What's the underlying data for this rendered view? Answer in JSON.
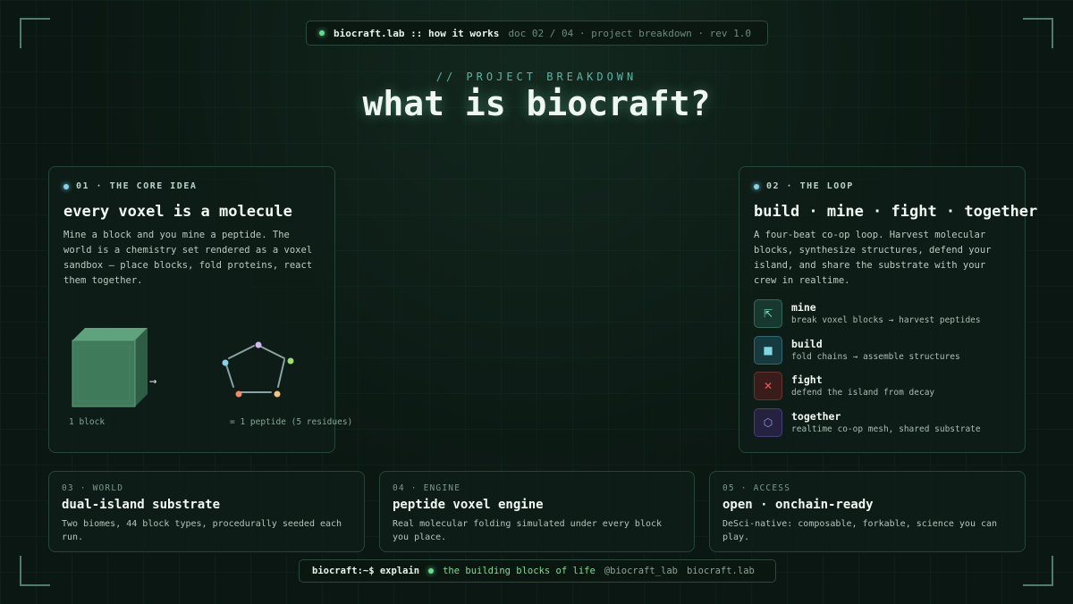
{
  "topbar": {
    "brand": "biocraft.lab :: how it works",
    "meta": "doc 02 / 04 · project breakdown · rev 1.0"
  },
  "hero": {
    "eyebrow": "// PROJECT BREAKDOWN",
    "title": "what is biocraft?"
  },
  "core_idea": {
    "tag": "01 · THE CORE IDEA",
    "title": "every voxel is a molecule",
    "body": "Mine a block and you mine a peptide. The world is a chemistry set rendered as a voxel sandbox — place blocks, fold proteins, react them together.",
    "arrow": "→",
    "caption_left": "1 block",
    "caption_right": "= 1 peptide (5 residues)",
    "colors": {
      "cube": "#4a8f6a",
      "residues": [
        "#d7b4f2",
        "#9be06b",
        "#f2c57a",
        "#f28a6a",
        "#7fd4ec"
      ]
    }
  },
  "loop": {
    "tag": "02 · THE LOOP",
    "title": "build · mine · fight · together",
    "body": "A four-beat co-op loop. Harvest molecular blocks, synthesize structures, defend your island, and share the substrate with your crew in realtime.",
    "items": [
      {
        "icon": "⇱",
        "icon_name": "pickaxe-icon",
        "name": "mine",
        "desc": "break voxel blocks → harvest peptides"
      },
      {
        "icon": "■",
        "icon_name": "block-icon",
        "name": "build",
        "desc": "fold chains → assemble structures"
      },
      {
        "icon": "✕",
        "icon_name": "swords-icon",
        "name": "fight",
        "desc": "defend the island from decay"
      },
      {
        "icon": "⬡",
        "icon_name": "hexagon-icon",
        "name": "together",
        "desc": "realtime co-op mesh, shared substrate"
      }
    ]
  },
  "features": [
    {
      "tag": "03 · WORLD",
      "title": "dual-island substrate",
      "body": "Two biomes, 44 block types, procedurally seeded each run."
    },
    {
      "tag": "04 · ENGINE",
      "title": "peptide voxel engine",
      "body": "Real molecular folding simulated under every block you place."
    },
    {
      "tag": "05 · ACCESS",
      "title": "open · onchain-ready",
      "body": "DeSci-native: composable, forkable, science you can play."
    }
  ],
  "bottombar": {
    "prompt": "biocraft:~$ explain",
    "tagline": "the building blocks of life",
    "handle": "@biocraft_lab",
    "site": "biocraft.lab"
  }
}
